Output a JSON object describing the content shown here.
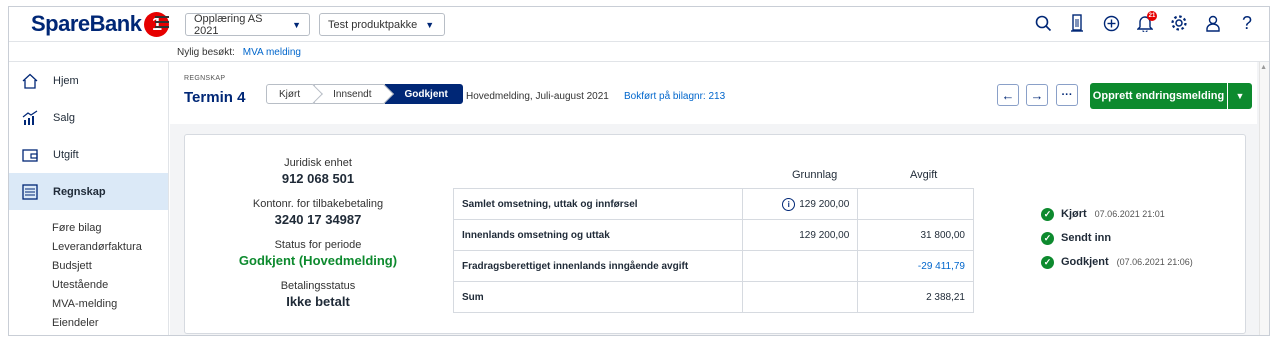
{
  "topbar": {
    "logo_text": "SpareBank",
    "logo_number": "1",
    "company_select": "Opplæring AS  2021",
    "product_select": "Test produktpakke",
    "notification_count": "21"
  },
  "recent": {
    "label": "Nylig besøkt:",
    "link": "MVA melding"
  },
  "sidebar": {
    "items": [
      {
        "label": "Hjem"
      },
      {
        "label": "Salg"
      },
      {
        "label": "Utgift"
      },
      {
        "label": "Regnskap"
      }
    ],
    "subitems": [
      "Føre bilag",
      "Leverandørfaktura",
      "Budsjett",
      "Utestående",
      "MVA-melding",
      "Eiendeler"
    ]
  },
  "header": {
    "section_label": "REGNSKAP",
    "title": "Termin 4",
    "steps": [
      "Kjørt",
      "Innsendt",
      "Godkjent"
    ],
    "description": "Hovedmelding, Juli-august 2021",
    "bokfort": "Bokført på bilagnr: 213",
    "primary_button": "Opprett endringsmelding"
  },
  "info": {
    "juridisk_label": "Juridisk enhet",
    "juridisk_value": "912 068 501",
    "konto_label": "Kontonr. for tilbakebetaling",
    "konto_value": "3240 17 34987",
    "status_label": "Status for periode",
    "status_value": "Godkjent (Hovedmelding)",
    "betaling_label": "Betalingsstatus",
    "betaling_value": "Ikke betalt"
  },
  "table": {
    "col_grunnlag": "Grunnlag",
    "col_avgift": "Avgift",
    "rows": [
      {
        "label": "Samlet omsetning, uttak og innførsel",
        "grunnlag": "129 200,00",
        "avgift": ""
      },
      {
        "label": "Innenlands omsetning og uttak",
        "grunnlag": "129 200,00",
        "avgift": "31 800,00"
      },
      {
        "label": "Fradragsberettiget innenlands inngående avgift",
        "grunnlag": "",
        "avgift": "-29 411,79"
      },
      {
        "label": "Sum",
        "grunnlag": "",
        "avgift": "2 388,21"
      }
    ]
  },
  "statuses": [
    {
      "name": "Kjørt",
      "time": "07.06.2021 21:01"
    },
    {
      "name": "Sendt inn",
      "time": ""
    },
    {
      "name": "Godkjent",
      "time": "(07.06.2021 21:06)"
    }
  ]
}
